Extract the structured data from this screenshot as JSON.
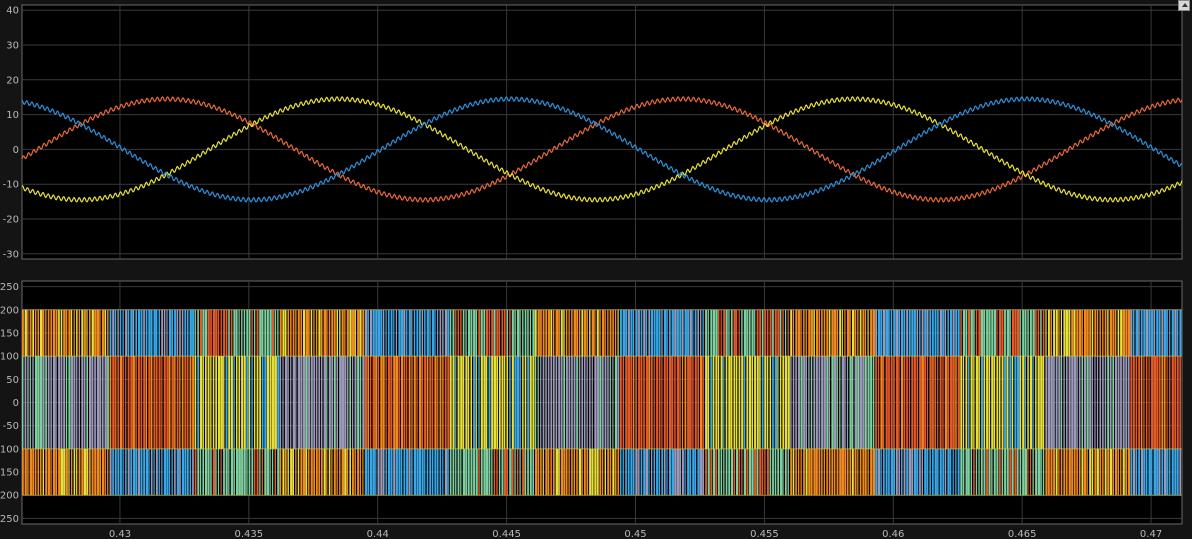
{
  "window": {
    "undock_icon": "undock-arrow-icon"
  },
  "chart_data": [
    {
      "type": "line",
      "title": "",
      "xlabel": "",
      "ylabel": "",
      "xlim": [
        0.4262,
        0.4712
      ],
      "ylim": [
        -31.5,
        41.5
      ],
      "grid": true,
      "x_ticks": [
        0.43,
        0.435,
        0.44,
        0.445,
        0.45,
        0.455,
        0.46,
        0.465,
        0.47
      ],
      "y_ticks": [
        40,
        30,
        20,
        10,
        0,
        -10,
        -20,
        -30
      ],
      "wave": {
        "amplitude": 14.5,
        "frequency_hz": 50,
        "ripple": 0.6
      },
      "series": [
        {
          "color": "#e86a3a",
          "phase_deg": 0
        },
        {
          "color": "#e8e03a",
          "phase_deg": -120
        },
        {
          "color": "#2f8fd8",
          "phase_deg": 120
        }
      ]
    },
    {
      "type": "line",
      "title": "",
      "xlabel": "",
      "ylabel": "",
      "xlim": [
        0.4262,
        0.4712
      ],
      "ylim": [
        -262,
        262
      ],
      "grid": true,
      "y_ticks": [
        250,
        200,
        150,
        100,
        50,
        0,
        -50,
        -100,
        -150,
        -200,
        -250
      ],
      "levels": [
        200,
        100,
        -100,
        -200
      ],
      "pwm": {
        "carrier_khz": 5
      },
      "series": [
        {
          "color": "#f08a1e"
        },
        {
          "color": "#e8e03a"
        },
        {
          "color": "#3aa8e8"
        },
        {
          "color": "#9a9ab8"
        },
        {
          "color": "#7ed0a0"
        },
        {
          "color": "#e25a28"
        }
      ]
    }
  ]
}
